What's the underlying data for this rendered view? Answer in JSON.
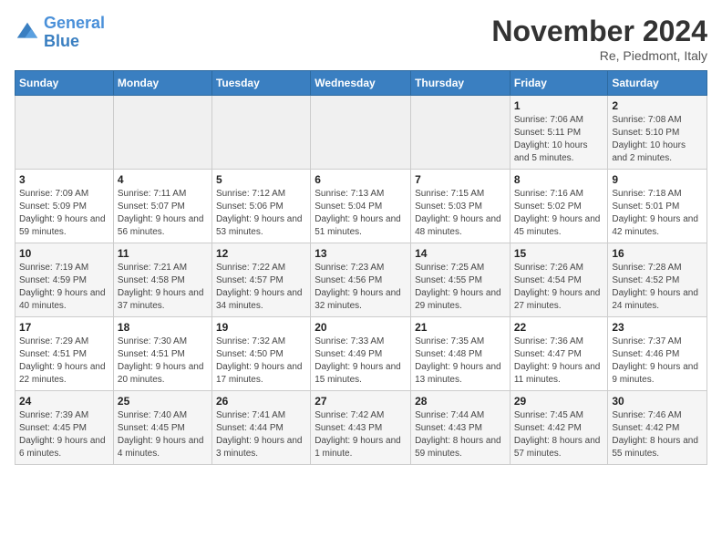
{
  "header": {
    "logo_line1": "General",
    "logo_line2": "Blue",
    "month_title": "November 2024",
    "subtitle": "Re, Piedmont, Italy"
  },
  "weekdays": [
    "Sunday",
    "Monday",
    "Tuesday",
    "Wednesday",
    "Thursday",
    "Friday",
    "Saturday"
  ],
  "weeks": [
    [
      {
        "day": "",
        "info": ""
      },
      {
        "day": "",
        "info": ""
      },
      {
        "day": "",
        "info": ""
      },
      {
        "day": "",
        "info": ""
      },
      {
        "day": "",
        "info": ""
      },
      {
        "day": "1",
        "info": "Sunrise: 7:06 AM\nSunset: 5:11 PM\nDaylight: 10 hours and 5 minutes."
      },
      {
        "day": "2",
        "info": "Sunrise: 7:08 AM\nSunset: 5:10 PM\nDaylight: 10 hours and 2 minutes."
      }
    ],
    [
      {
        "day": "3",
        "info": "Sunrise: 7:09 AM\nSunset: 5:09 PM\nDaylight: 9 hours and 59 minutes."
      },
      {
        "day": "4",
        "info": "Sunrise: 7:11 AM\nSunset: 5:07 PM\nDaylight: 9 hours and 56 minutes."
      },
      {
        "day": "5",
        "info": "Sunrise: 7:12 AM\nSunset: 5:06 PM\nDaylight: 9 hours and 53 minutes."
      },
      {
        "day": "6",
        "info": "Sunrise: 7:13 AM\nSunset: 5:04 PM\nDaylight: 9 hours and 51 minutes."
      },
      {
        "day": "7",
        "info": "Sunrise: 7:15 AM\nSunset: 5:03 PM\nDaylight: 9 hours and 48 minutes."
      },
      {
        "day": "8",
        "info": "Sunrise: 7:16 AM\nSunset: 5:02 PM\nDaylight: 9 hours and 45 minutes."
      },
      {
        "day": "9",
        "info": "Sunrise: 7:18 AM\nSunset: 5:01 PM\nDaylight: 9 hours and 42 minutes."
      }
    ],
    [
      {
        "day": "10",
        "info": "Sunrise: 7:19 AM\nSunset: 4:59 PM\nDaylight: 9 hours and 40 minutes."
      },
      {
        "day": "11",
        "info": "Sunrise: 7:21 AM\nSunset: 4:58 PM\nDaylight: 9 hours and 37 minutes."
      },
      {
        "day": "12",
        "info": "Sunrise: 7:22 AM\nSunset: 4:57 PM\nDaylight: 9 hours and 34 minutes."
      },
      {
        "day": "13",
        "info": "Sunrise: 7:23 AM\nSunset: 4:56 PM\nDaylight: 9 hours and 32 minutes."
      },
      {
        "day": "14",
        "info": "Sunrise: 7:25 AM\nSunset: 4:55 PM\nDaylight: 9 hours and 29 minutes."
      },
      {
        "day": "15",
        "info": "Sunrise: 7:26 AM\nSunset: 4:54 PM\nDaylight: 9 hours and 27 minutes."
      },
      {
        "day": "16",
        "info": "Sunrise: 7:28 AM\nSunset: 4:52 PM\nDaylight: 9 hours and 24 minutes."
      }
    ],
    [
      {
        "day": "17",
        "info": "Sunrise: 7:29 AM\nSunset: 4:51 PM\nDaylight: 9 hours and 22 minutes."
      },
      {
        "day": "18",
        "info": "Sunrise: 7:30 AM\nSunset: 4:51 PM\nDaylight: 9 hours and 20 minutes."
      },
      {
        "day": "19",
        "info": "Sunrise: 7:32 AM\nSunset: 4:50 PM\nDaylight: 9 hours and 17 minutes."
      },
      {
        "day": "20",
        "info": "Sunrise: 7:33 AM\nSunset: 4:49 PM\nDaylight: 9 hours and 15 minutes."
      },
      {
        "day": "21",
        "info": "Sunrise: 7:35 AM\nSunset: 4:48 PM\nDaylight: 9 hours and 13 minutes."
      },
      {
        "day": "22",
        "info": "Sunrise: 7:36 AM\nSunset: 4:47 PM\nDaylight: 9 hours and 11 minutes."
      },
      {
        "day": "23",
        "info": "Sunrise: 7:37 AM\nSunset: 4:46 PM\nDaylight: 9 hours and 9 minutes."
      }
    ],
    [
      {
        "day": "24",
        "info": "Sunrise: 7:39 AM\nSunset: 4:45 PM\nDaylight: 9 hours and 6 minutes."
      },
      {
        "day": "25",
        "info": "Sunrise: 7:40 AM\nSunset: 4:45 PM\nDaylight: 9 hours and 4 minutes."
      },
      {
        "day": "26",
        "info": "Sunrise: 7:41 AM\nSunset: 4:44 PM\nDaylight: 9 hours and 3 minutes."
      },
      {
        "day": "27",
        "info": "Sunrise: 7:42 AM\nSunset: 4:43 PM\nDaylight: 9 hours and 1 minute."
      },
      {
        "day": "28",
        "info": "Sunrise: 7:44 AM\nSunset: 4:43 PM\nDaylight: 8 hours and 59 minutes."
      },
      {
        "day": "29",
        "info": "Sunrise: 7:45 AM\nSunset: 4:42 PM\nDaylight: 8 hours and 57 minutes."
      },
      {
        "day": "30",
        "info": "Sunrise: 7:46 AM\nSunset: 4:42 PM\nDaylight: 8 hours and 55 minutes."
      }
    ]
  ]
}
